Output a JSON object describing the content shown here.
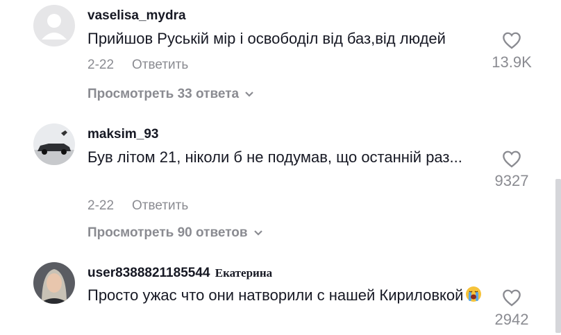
{
  "comments": [
    {
      "username": "vaselisa_mydra",
      "display_name": "",
      "text": "Прийшов Руськiй мiр i освободiл вiд баз,вiд людей",
      "date": "2-22",
      "reply_label": "Ответить",
      "likes": "13.9K",
      "view_replies": "Просмотреть 33 ответа",
      "avatar": "default-avatar"
    },
    {
      "username": "maksim_93",
      "display_name": "",
      "text": "Був лiтом 21, нiколи б не подумав, що останнiй раз...",
      "date": "2-22",
      "reply_label": "Ответить",
      "likes": "9327",
      "view_replies": "Просмотреть 90 ответов",
      "avatar": "car-photo-avatar"
    },
    {
      "username": "user8388821185544",
      "display_name": "Екатерина",
      "text": "Просто ужас что они натворили с нашей Кириловкой",
      "emoji": "loudly-crying-face",
      "likes": "2942",
      "avatar": "woman-photo-avatar"
    }
  ],
  "colors": {
    "text": "#161823",
    "muted": "#8a8b91",
    "scrollbar": "#d5d6da"
  },
  "icons": [
    "heart-outline-icon",
    "chevron-down-icon"
  ]
}
